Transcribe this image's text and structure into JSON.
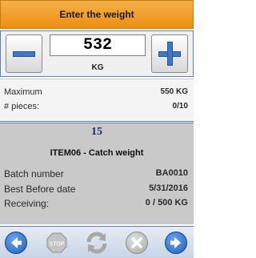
{
  "header": {
    "title": "Enter the weight"
  },
  "quantity": {
    "value": "532",
    "unit": "KG"
  },
  "limits": {
    "maximum_label": "Maximum",
    "maximum_value": "550 KG",
    "pieces_label": "# pieces:",
    "pieces_value": "0/10"
  },
  "detail": {
    "count": "15",
    "item_title": "ITEM06 - Catch weight",
    "batch_label": "Batch number",
    "batch_value": "BA0010",
    "best_before_label": "Best Before date",
    "best_before_value": "5/31/2016",
    "receiving_label": "Receiving:",
    "receiving_value": "0 / 500 KG"
  },
  "toolbar": {
    "stop_label": "STOP",
    "icons": [
      "back-arrow-icon",
      "stop-icon",
      "refresh-icon",
      "cancel-icon",
      "forward-arrow-icon"
    ],
    "enabled": {
      "back": true,
      "stop": false,
      "refresh": false,
      "cancel": false,
      "forward": true
    }
  },
  "colors": {
    "header": "#ec8f10",
    "accent_blue": "#3f78c8",
    "count_text": "#1c2b6b"
  }
}
